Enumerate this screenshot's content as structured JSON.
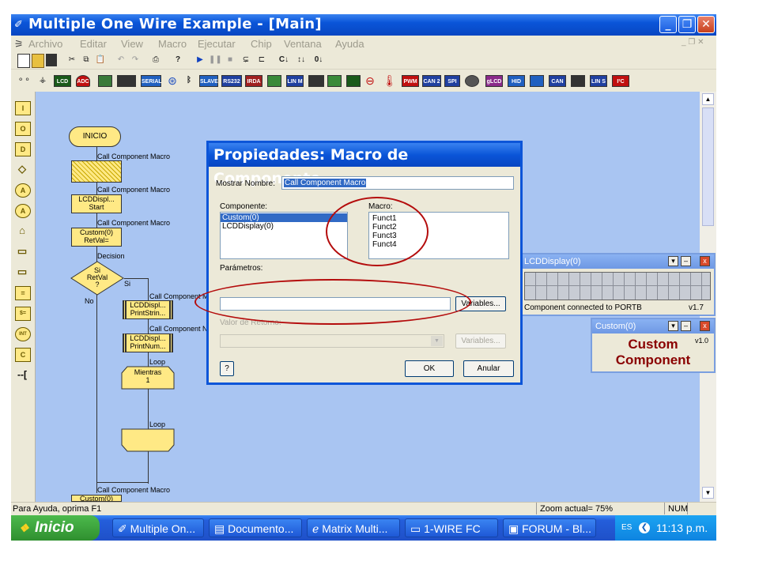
{
  "window": {
    "title": "Multiple One Wire Example - [Main]",
    "btn_min": "_",
    "btn_max": "❐",
    "btn_close": "✕"
  },
  "menu": [
    "Archivo",
    "Editar",
    "View",
    "Macro",
    "Ejecutar",
    "Chip",
    "Ventana",
    "Ayuda"
  ],
  "toolbar2": {
    "lcd": "LCD",
    "adc": "ADC",
    "serial": "SERIAL",
    "slave": "SLAVE",
    "rs232": "RS232",
    "irda": "IRDA",
    "lin_m": "LIN M",
    "pwm": "PWM",
    "can2": "CAN 2",
    "spi": "SPI",
    "glcd": "gLCD",
    "hid": "HID",
    "can": "CAN",
    "lin_s": "LIN S",
    "i2c": "I²C"
  },
  "toolbar1": {
    "icons": [
      "new-icon",
      "open-icon",
      "save-icon",
      "cut-icon",
      "copy-icon",
      "paste-icon",
      "undo-icon",
      "redo-icon",
      "print-icon",
      "help-icon",
      "run-icon",
      "pause-icon",
      "stop-icon",
      "step-into-icon",
      "step-over-icon",
      "c-code-icon",
      "compile-icon",
      "chip-icon"
    ],
    "c_label": "C",
    "text_c": "C↓",
    "text_bits": "↕↓",
    "text_01": "0↓"
  },
  "leftbar": {
    "labels": [
      "I",
      "O",
      "D",
      "◇",
      "A",
      "A",
      "⌂",
      "▭",
      "▭",
      "=",
      "$=",
      "INT",
      "C",
      "--["
    ]
  },
  "flowchart": {
    "inicio": "INICIO",
    "call1": "Call Component Macro",
    "call2": "Call Component Macro",
    "box2": [
      "LCDDispl...",
      "Start"
    ],
    "call3": "Call Component Macro",
    "box3": [
      "Custom(0)",
      "RetVal="
    ],
    "decision_label": "Decision",
    "decision": [
      "Si",
      "RetVal",
      "?"
    ],
    "si": "Si",
    "no": "No",
    "call4": "Call Component M",
    "box4": [
      "LCDDispl...",
      "PrintStrin..."
    ],
    "call5": "Call Component N",
    "box5": [
      "LCDDispl...",
      "PrintNum..."
    ],
    "loop1": "Loop",
    "mientras": [
      "Mientras",
      "1"
    ],
    "loop2": "Loop",
    "call6": "Call Component Macro",
    "bottom_box": "Custom(0)"
  },
  "dialog": {
    "title": "Propiedades: Macro de Componente",
    "mostrar_label": "Mostrar Nombre:",
    "mostrar_value": "Call Component Macro",
    "componente_label": "Componente:",
    "componentes": [
      "Custom(0)",
      "LCDDisplay(0)"
    ],
    "macro_label": "Macro:",
    "macros": [
      "Funct1",
      "Funct2",
      "Funct3",
      "Funct4"
    ],
    "parametros_label": "Parámetros:",
    "variables_btn": "Variables...",
    "valor_label": "Valor de Retorno:",
    "variables_btn2": "Variables...",
    "help_btn": "?",
    "ok_btn": "OK",
    "cancel_btn": "Anular",
    "combo_arrow": "▼"
  },
  "lcd_window": {
    "title": "LCDDisplay(0)",
    "caption": "Component connected to PORTB",
    "version": "v1.7",
    "btn_collapse": "▾",
    "btn_min": "–",
    "btn_close": "x"
  },
  "custom_window": {
    "title": "Custom(0)",
    "text": [
      "Custom",
      "Component"
    ],
    "version": "v1.0",
    "btn_collapse": "▾",
    "btn_min": "–",
    "btn_close": "x"
  },
  "scroll": {
    "up": "▲",
    "down": "▼"
  },
  "status": {
    "help": "Para Ayuda, oprima F1",
    "zoom": "Zoom actual= 75%",
    "num": "NUM"
  },
  "taskbar": {
    "start": "Inicio",
    "tasks": [
      "Multiple On...",
      "Documento...",
      "Matrix Multi...",
      "1-WIRE FC",
      "FORUM - Bl..."
    ],
    "task_icons": [
      "flowcode-icon",
      "document-icon",
      "browser-icon",
      "folder-icon",
      "forum-icon"
    ],
    "lang": "ES",
    "time": "11:13 p.m."
  }
}
